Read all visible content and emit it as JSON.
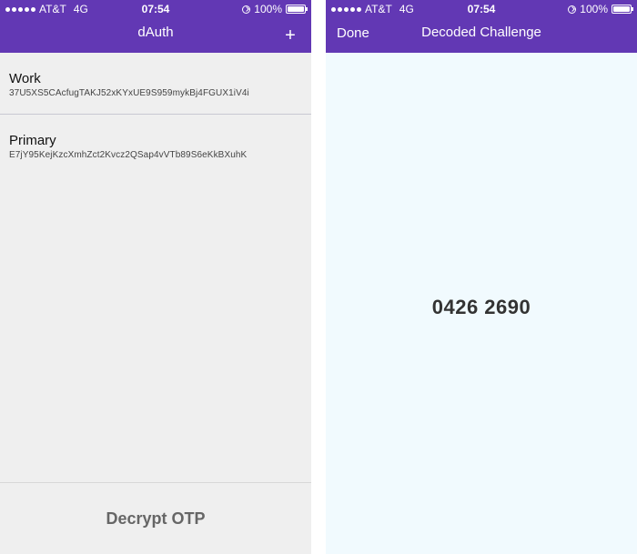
{
  "left_screen": {
    "statusbar": {
      "carrier": "AT&T",
      "network": "4G",
      "time": "07:54",
      "battery": "100%",
      "battery_level": 1.0
    },
    "nav": {
      "title": "dAuth",
      "add_label": "+"
    },
    "accounts": [
      {
        "name": "Work",
        "key": "37U5XS5CAcfugTAKJ52xKYxUE9S959mykBj4FGUX1iV4i"
      },
      {
        "name": "Primary",
        "key": "E7jY95KejKzcXmhZct2Kvcz2QSap4vVTb89S6eKkBXuhK"
      }
    ],
    "footer": {
      "decrypt_label": "Decrypt OTP"
    }
  },
  "right_screen": {
    "statusbar": {
      "carrier": "AT&T",
      "network": "4G",
      "time": "07:54",
      "battery": "100%",
      "battery_level": 1.0
    },
    "nav": {
      "done_label": "Done",
      "title": "Decoded Challenge"
    },
    "code": "0426 2690"
  },
  "colors": {
    "accent": "#6238b4",
    "left_bg": "#efefef",
    "right_bg": "#f1fafe"
  },
  "icons": [
    "signal-dots-icon",
    "lock-rotation-icon",
    "battery-icon",
    "plus-icon"
  ]
}
